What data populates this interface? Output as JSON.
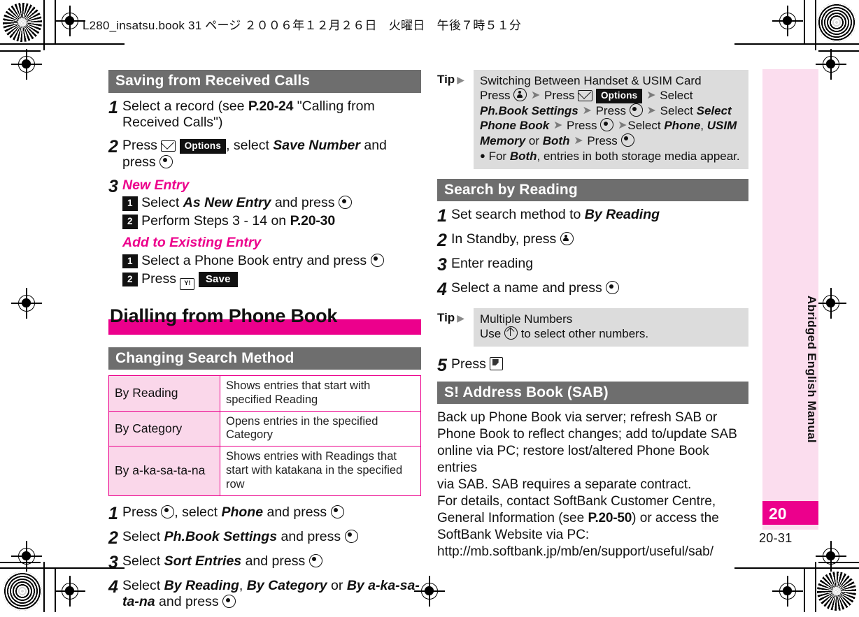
{
  "header": {
    "file_line": "L280_insatsu.book  31 ページ  ２００６年１２月２６日　火曜日　午後７時５１分"
  },
  "colors": {
    "magenta": "#ec008c",
    "light_pink": "#fbddee",
    "table_pink": "#fad7ea",
    "gray_bar": "#6e6e6e",
    "tip_gray": "#dcdcdc"
  },
  "left_column": {
    "section1": {
      "heading": "Saving from Received Calls",
      "steps": [
        {
          "num": "1",
          "parts": [
            {
              "t": "text",
              "v": "Select a record (see "
            },
            {
              "t": "ref",
              "v": "P.20-24"
            },
            {
              "t": "text",
              "v": " \"Calling from Received Calls\")"
            }
          ]
        },
        {
          "num": "2",
          "parts": [
            {
              "t": "text",
              "v": "Press "
            },
            {
              "t": "icon",
              "v": "mail-key-icon"
            },
            {
              "t": "softkey",
              "v": "Options"
            },
            {
              "t": "text",
              "v": ", select "
            },
            {
              "t": "italic",
              "v": "Save Number"
            },
            {
              "t": "text",
              "v": " and press "
            },
            {
              "t": "icon",
              "v": "center-key-icon"
            }
          ]
        }
      ],
      "step3": {
        "num": "3",
        "group_a": {
          "title": "New Entry",
          "items": [
            {
              "marker": "1",
              "parts": [
                {
                  "t": "text",
                  "v": "Select "
                },
                {
                  "t": "italic",
                  "v": "As New Entry"
                },
                {
                  "t": "text",
                  "v": " and press "
                },
                {
                  "t": "icon",
                  "v": "center-key-icon"
                }
              ]
            },
            {
              "marker": "2",
              "parts": [
                {
                  "t": "text",
                  "v": "Perform Steps 3 - 14 on "
                },
                {
                  "t": "ref",
                  "v": "P.20-30"
                }
              ]
            }
          ]
        },
        "group_b": {
          "title": "Add to Existing Entry",
          "items": [
            {
              "marker": "1",
              "parts": [
                {
                  "t": "text",
                  "v": "Select a Phone Book entry and press "
                },
                {
                  "t": "icon",
                  "v": "center-key-icon"
                }
              ]
            },
            {
              "marker": "2",
              "parts": [
                {
                  "t": "text",
                  "v": "Press "
                },
                {
                  "t": "icon",
                  "v": "yahoo-key-icon"
                },
                {
                  "t": "softkey",
                  "v": "Save"
                }
              ]
            }
          ]
        }
      }
    },
    "chapter_heading": "Dialling from Phone Book",
    "section2": {
      "heading": "Changing Search Method",
      "table": {
        "rows": [
          {
            "label": "By Reading",
            "desc": "Shows entries that start with specified Reading"
          },
          {
            "label": "By Category",
            "desc": "Opens entries in the specified Category"
          },
          {
            "label": "By a-ka-sa-ta-na",
            "desc": "Shows entries with Readings that start with katakana in the specified row"
          }
        ]
      },
      "steps": [
        {
          "num": "1",
          "parts": [
            {
              "t": "text",
              "v": "Press "
            },
            {
              "t": "icon",
              "v": "center-key-icon"
            },
            {
              "t": "text",
              "v": ", select "
            },
            {
              "t": "italic",
              "v": "Phone"
            },
            {
              "t": "text",
              "v": " and press "
            },
            {
              "t": "icon",
              "v": "center-key-icon"
            }
          ]
        },
        {
          "num": "2",
          "parts": [
            {
              "t": "text",
              "v": "Select "
            },
            {
              "t": "italic",
              "v": "Ph.Book Settings"
            },
            {
              "t": "text",
              "v": " and press "
            },
            {
              "t": "icon",
              "v": "center-key-icon"
            }
          ]
        },
        {
          "num": "3",
          "parts": [
            {
              "t": "text",
              "v": "Select "
            },
            {
              "t": "italic",
              "v": "Sort Entries"
            },
            {
              "t": "text",
              "v": " and press "
            },
            {
              "t": "icon",
              "v": "center-key-icon"
            }
          ]
        },
        {
          "num": "4",
          "parts": [
            {
              "t": "text",
              "v": "Select "
            },
            {
              "t": "italic",
              "v": "By Reading"
            },
            {
              "t": "text",
              "v": ", "
            },
            {
              "t": "italic",
              "v": "By Category"
            },
            {
              "t": "text",
              "v": " or "
            },
            {
              "t": "italic",
              "v": "By a-ka-sa-ta-na"
            },
            {
              "t": "text",
              "v": " and press "
            },
            {
              "t": "icon",
              "v": "center-key-icon"
            }
          ]
        }
      ]
    }
  },
  "right_column": {
    "tip1": {
      "label": "Tip",
      "title": "Switching Between Handset & USIM Card",
      "parts": [
        {
          "t": "text",
          "v": "Press "
        },
        {
          "t": "icon",
          "v": "phonebook-key-icon"
        },
        {
          "t": "arrow",
          "v": "➜"
        },
        {
          "t": "text",
          "v": " Press "
        },
        {
          "t": "icon",
          "v": "mail-key-icon"
        },
        {
          "t": "softkey",
          "v": "Options"
        },
        {
          "t": "arrow",
          "v": "➜"
        },
        {
          "t": "text",
          "v": " Select "
        },
        {
          "t": "italic",
          "v": "Ph.Book Settings"
        },
        {
          "t": "arrow",
          "v": "➜"
        },
        {
          "t": "text",
          "v": " Press "
        },
        {
          "t": "icon",
          "v": "center-key-icon"
        },
        {
          "t": "arrow",
          "v": "➜"
        },
        {
          "t": "text",
          "v": " Select "
        },
        {
          "t": "italic",
          "v": "Select Phone Book"
        },
        {
          "t": "arrow",
          "v": "➜"
        },
        {
          "t": "text",
          "v": " Press "
        },
        {
          "t": "icon",
          "v": "center-key-icon"
        },
        {
          "t": "arrow",
          "v": "➜"
        },
        {
          "t": "text",
          "v": "Select "
        },
        {
          "t": "italic",
          "v": "Phone"
        },
        {
          "t": "text",
          "v": ", "
        },
        {
          "t": "italic",
          "v": "USIM Memory"
        },
        {
          "t": "text",
          "v": " or "
        },
        {
          "t": "italic",
          "v": "Both"
        },
        {
          "t": "arrow",
          "v": "➜"
        },
        {
          "t": "text",
          "v": " Press "
        },
        {
          "t": "icon",
          "v": "center-key-icon"
        }
      ],
      "bullet": [
        {
          "t": "text",
          "v": "For "
        },
        {
          "t": "italic",
          "v": "Both"
        },
        {
          "t": "text",
          "v": ", entries in both storage media appear."
        }
      ]
    },
    "section1": {
      "heading": "Search by Reading",
      "steps": [
        {
          "num": "1",
          "parts": [
            {
              "t": "text",
              "v": "Set search method to "
            },
            {
              "t": "italic",
              "v": "By Reading"
            }
          ]
        },
        {
          "num": "2",
          "parts": [
            {
              "t": "text",
              "v": "In Standby, press "
            },
            {
              "t": "icon",
              "v": "phonebook-key-icon"
            }
          ]
        },
        {
          "num": "3",
          "parts": [
            {
              "t": "text",
              "v": "Enter reading"
            }
          ]
        },
        {
          "num": "4",
          "parts": [
            {
              "t": "text",
              "v": "Select a name and press "
            },
            {
              "t": "icon",
              "v": "center-key-icon"
            }
          ]
        }
      ]
    },
    "tip2": {
      "label": "Tip",
      "title": "Multiple Numbers",
      "parts": [
        {
          "t": "text",
          "v": "Use "
        },
        {
          "t": "icon",
          "v": "updown-key-icon"
        },
        {
          "t": "text",
          "v": " to select other numbers."
        }
      ]
    },
    "step5": {
      "num": "5",
      "parts": [
        {
          "t": "text",
          "v": "Press "
        },
        {
          "t": "icon",
          "v": "send-key-icon"
        }
      ]
    },
    "section2": {
      "heading": "S! Address Book (SAB)",
      "paragraph_lines": [
        "Back up Phone Book via server; refresh SAB or",
        "Phone Book to reflect changes; add to/update SAB",
        "online via PC; restore lost/altered Phone Book entries",
        "via SAB. SAB requires a separate contract.",
        "For details, contact SoftBank Customer Centre,",
        "General Information (see P.20-50) or access the",
        "SoftBank Website via PC:",
        "http://mb.softbank.jp/mb/en/support/useful/sab/"
      ],
      "page_ref": "P.20-50"
    }
  },
  "sidebar": {
    "vertical_label": "Abridged English Manual",
    "chapter_number": "20"
  },
  "footer": {
    "page_number": "20-31"
  }
}
